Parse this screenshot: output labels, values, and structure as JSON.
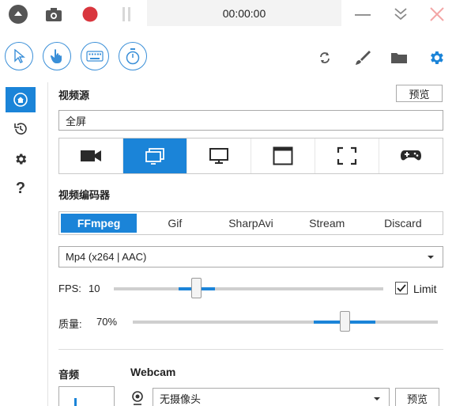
{
  "window": {
    "timer": "00:00:00"
  },
  "titlebar": {
    "buttons": [
      {
        "name": "eject",
        "icon": "eject-icon"
      },
      {
        "name": "snapshot",
        "icon": "camera-icon"
      },
      {
        "name": "record",
        "icon": "record-icon"
      },
      {
        "name": "pause",
        "icon": "pause-icon"
      },
      {
        "name": "minimize",
        "icon": "minimize-icon"
      },
      {
        "name": "collapse",
        "icon": "chevrons-down-icon"
      },
      {
        "name": "close",
        "icon": "close-icon"
      }
    ]
  },
  "toolbar": {
    "modes": [
      {
        "name": "cursor",
        "icon": "cursor-icon"
      },
      {
        "name": "touch",
        "icon": "hand-pointer-icon"
      },
      {
        "name": "keyboard",
        "icon": "keyboard-icon"
      },
      {
        "name": "timer",
        "icon": "stopwatch-icon"
      }
    ],
    "tools": [
      {
        "name": "refresh",
        "icon": "refresh-icon"
      },
      {
        "name": "brush",
        "icon": "brush-icon"
      },
      {
        "name": "folder",
        "icon": "folder-icon"
      },
      {
        "name": "settings",
        "icon": "gear-icon"
      }
    ]
  },
  "sidebar": {
    "items": [
      {
        "name": "home",
        "icon": "home-icon",
        "active": true
      },
      {
        "name": "history",
        "icon": "history-icon"
      },
      {
        "name": "settings",
        "icon": "gear-icon"
      },
      {
        "name": "help",
        "icon": "question-icon",
        "glyph": "?"
      }
    ]
  },
  "video_source": {
    "label": "视频源",
    "preview_label": "预览",
    "value": "全屏",
    "tiles": [
      {
        "name": "camera",
        "icon": "video-camera-icon"
      },
      {
        "name": "window",
        "icon": "windows-icon",
        "active": true
      },
      {
        "name": "screen",
        "icon": "monitor-icon"
      },
      {
        "name": "app-window",
        "icon": "app-window-icon"
      },
      {
        "name": "region",
        "icon": "region-select-icon"
      },
      {
        "name": "game",
        "icon": "gamepad-icon"
      }
    ]
  },
  "video_encoder": {
    "label": "视频编码器",
    "tabs": [
      "FFmpeg",
      "Gif",
      "SharpAvi",
      "Stream",
      "Discard"
    ],
    "active_tab": "FFmpeg",
    "format": "Mp4 (x264 | AAC)"
  },
  "fps": {
    "label": "FPS:",
    "value": "10",
    "limit_label": "Limit",
    "limit_checked": true
  },
  "quality": {
    "label": "质量:",
    "value": "70%"
  },
  "audio": {
    "label": "音频"
  },
  "webcam": {
    "label": "Webcam",
    "value": "无摄像头",
    "preview_label": "预览"
  },
  "colors": {
    "accent": "#1b84d8",
    "record": "#d9363e",
    "close": "#f3a6a6"
  }
}
